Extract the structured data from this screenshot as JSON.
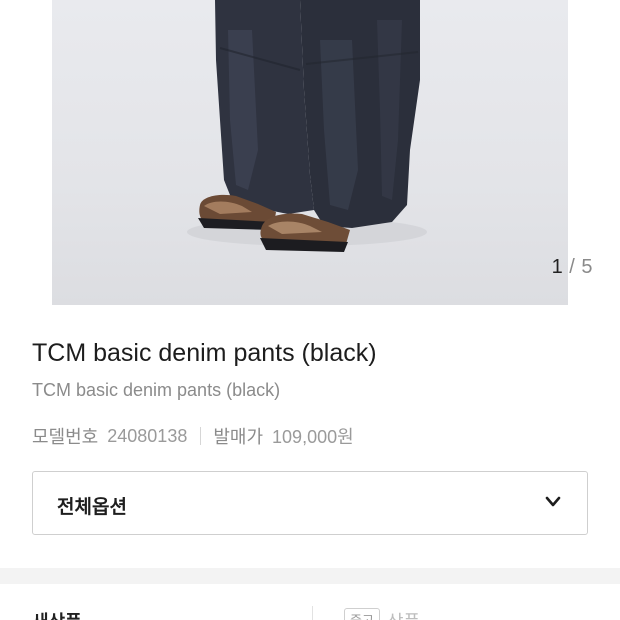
{
  "gallery": {
    "current": "1",
    "separator": "/",
    "total": "5"
  },
  "product": {
    "name": "TCM basic denim pants (black)",
    "subname": "TCM basic denim pants (black)",
    "model_label": "모델번호",
    "model_value": "24080138",
    "price_label": "발매가",
    "price_value": "109,000원"
  },
  "options": {
    "label": "전체옵션"
  },
  "tabs": {
    "new_label": "새상품",
    "used_badge": "중고",
    "used_label": "상품"
  }
}
